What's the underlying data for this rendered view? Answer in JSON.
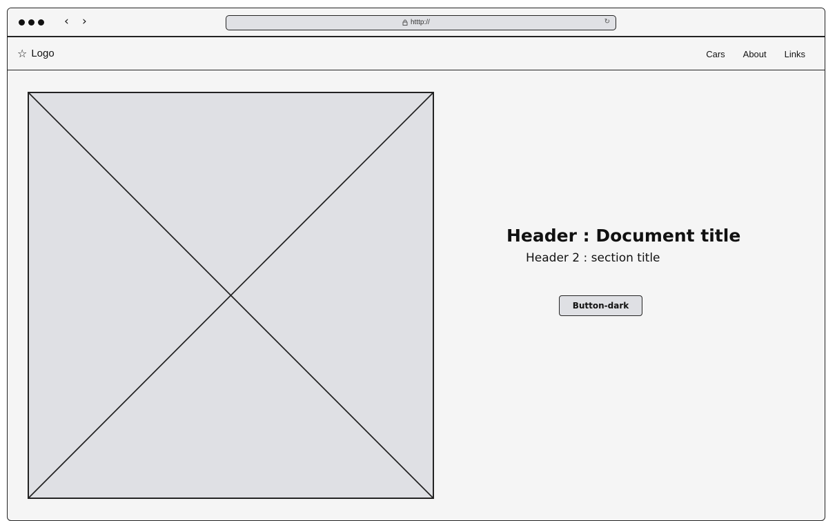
{
  "browser": {
    "url": "htttp://",
    "icons": {
      "window_controls": "dots-icon",
      "back": "chevron-left-icon",
      "forward": "chevron-right-icon",
      "lock": "lock-icon",
      "reload": "reload-icon"
    }
  },
  "navbar": {
    "logo_text": "Logo",
    "logo_icon": "star-icon",
    "links": [
      "Cars",
      "About",
      "Links"
    ]
  },
  "hero": {
    "image_placeholder_icon": "image-placeholder-icon",
    "title": "Header : Document title",
    "subtitle": "Header 2 : section title",
    "button_label": "Button-dark"
  },
  "colors": {
    "window_bg": "#f5f5f5",
    "placeholder_bg": "#dfe0e4",
    "stroke": "#222222"
  }
}
